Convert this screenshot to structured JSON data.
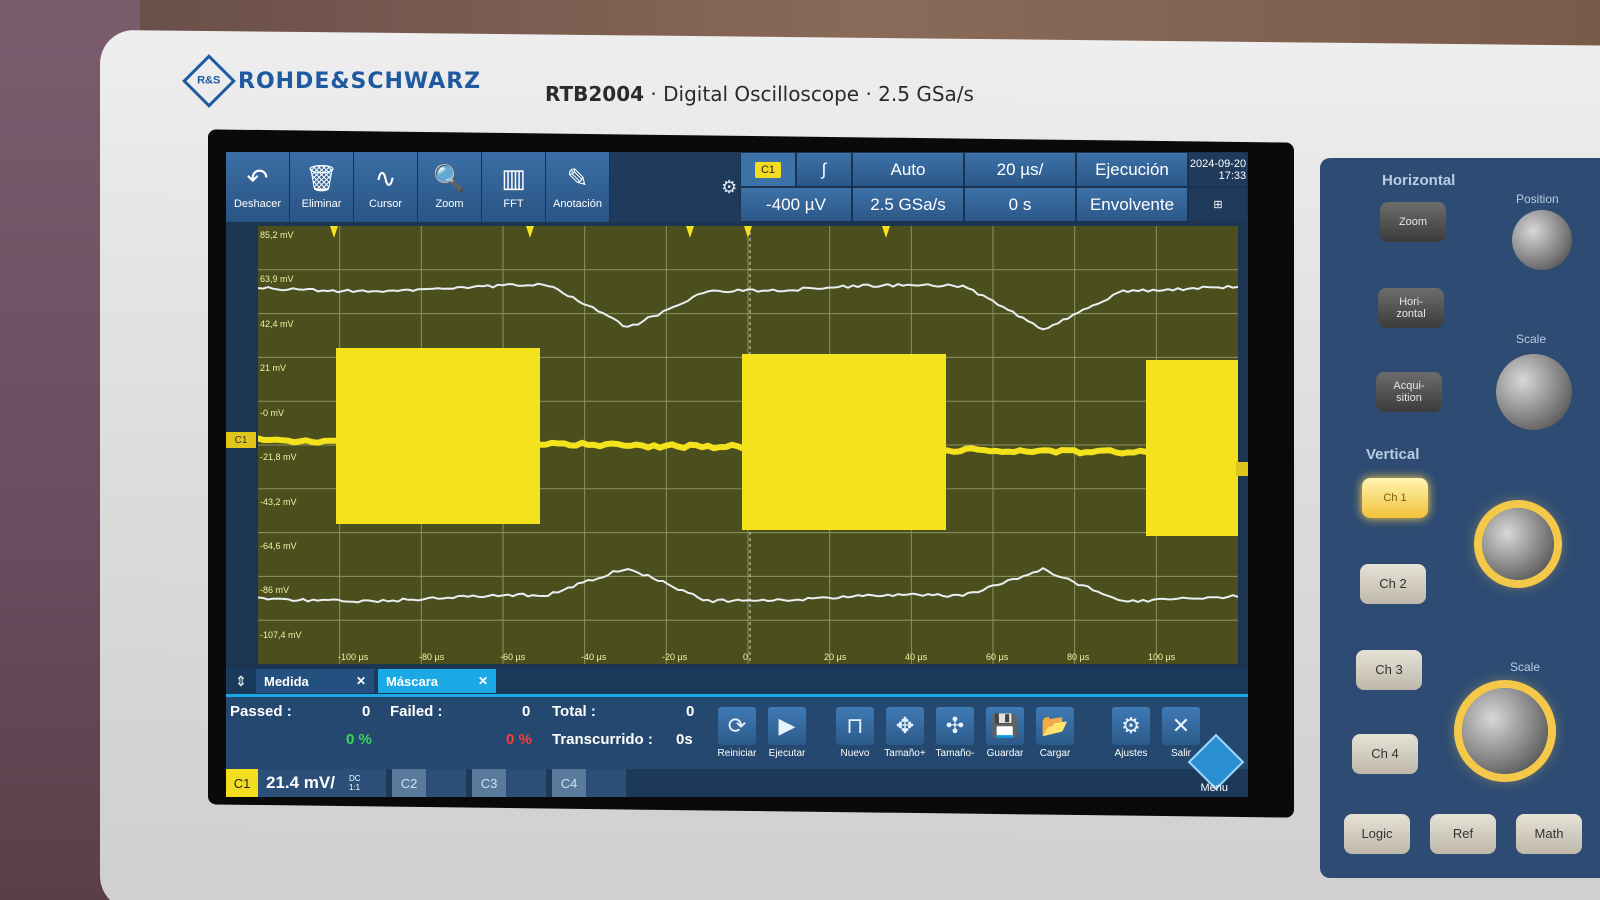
{
  "brand": {
    "logo_text": "R&S",
    "name": "ROHDE&SCHWARZ"
  },
  "model": {
    "name": "RTB2004",
    "description": "Digital Oscilloscope",
    "rate": "2.5 GSa/s",
    "separator": "·"
  },
  "toolbar": [
    {
      "glyph": "↶",
      "label": "Deshacer",
      "icon": "undo-icon"
    },
    {
      "glyph": "🗑",
      "label": "Eliminar",
      "icon": "trash-icon"
    },
    {
      "glyph": "∿",
      "label": "Cursor",
      "icon": "cursor-icon"
    },
    {
      "glyph": "🔍",
      "label": "Zoom",
      "icon": "zoom-icon"
    },
    {
      "glyph": "▥",
      "label": "FFT",
      "icon": "fft-icon"
    },
    {
      "glyph": "✎",
      "label": "Anotación",
      "icon": "pencil-icon"
    }
  ],
  "trigger": {
    "channel": "C1",
    "slope": "∫",
    "mode": "Auto",
    "timebase": "20 µs/",
    "run_state": "Ejecución",
    "level": "-400 µV",
    "sample_rate": "2.5 GSa/s",
    "offset": "0 s",
    "acq_mode": "Envolvente",
    "date": "2024-09-20",
    "time": "17:33"
  },
  "plot": {
    "y_labels": [
      "85,2 mV",
      "63,9 mV",
      "42,4 mV",
      "21 mV",
      "-0 mV",
      "-21,8 mV",
      "-43,2 mV",
      "-64,6 mV",
      "-86 mV",
      "-107,4 mV"
    ],
    "x_labels": [
      "-100 µs",
      "-80 µs",
      "-60 µs",
      "-40 µs",
      "-20 µs",
      "0",
      "20 µs",
      "40 µs",
      "60 µs",
      "80 µs",
      "100 µs"
    ],
    "marker": "C1",
    "trace_color": "#f4e21c",
    "ref_color": "#e8eef2",
    "grid_color": "#8c9260"
  },
  "tabs": [
    {
      "label": "Medida",
      "active": false
    },
    {
      "label": "Máscara",
      "active": true
    }
  ],
  "mask": {
    "passed_label": "Passed :",
    "passed_value": "0",
    "passed_pct": "0 %",
    "failed_label": "Failed :",
    "failed_value": "0",
    "failed_pct": "0 %",
    "total_label": "Total :",
    "total_value": "0",
    "elapsed_label": "Transcurrido :",
    "elapsed_value": "0s"
  },
  "actions": [
    {
      "glyph": "⟳",
      "label": "Reiniciar",
      "icon": "restart-icon"
    },
    {
      "glyph": "▶",
      "label": "Ejecutar",
      "icon": "play-icon"
    },
    {
      "glyph": "⊓",
      "label": "Nuevo",
      "icon": "new-mask-icon"
    },
    {
      "glyph": "✥",
      "label": "Tamaño+",
      "icon": "size-plus-icon"
    },
    {
      "glyph": "✣",
      "label": "Tamaño-",
      "icon": "size-minus-icon"
    },
    {
      "glyph": "💾",
      "label": "Guardar",
      "icon": "save-icon"
    },
    {
      "glyph": "📂",
      "label": "Cargar",
      "icon": "load-icon"
    },
    {
      "glyph": "⚙",
      "label": "Ajustes",
      "icon": "settings-icon"
    },
    {
      "glyph": "✕",
      "label": "Salir",
      "icon": "exit-icon"
    }
  ],
  "channels": {
    "c1": "C1",
    "c1_scale": "21.4 mV/",
    "c1_coupling": "DC",
    "c1_probe": "1:1",
    "c2": "C2",
    "c3": "C3",
    "c4": "C4"
  },
  "menu_label": "Menu",
  "side": {
    "horizontal": "Horizontal",
    "zoom": "Zoom",
    "horizontal_btn": "Hori-\nzontal",
    "acquisition_btn": "Acqui-\nsition",
    "position": "Position",
    "scale": "Scale",
    "vertical": "Vertical",
    "ch1": "Ch 1",
    "ch2": "Ch 2",
    "ch3": "Ch 3",
    "ch4": "Ch 4",
    "scale2": "Scale",
    "logic": "Logic",
    "ref": "Ref",
    "math": "Math"
  }
}
